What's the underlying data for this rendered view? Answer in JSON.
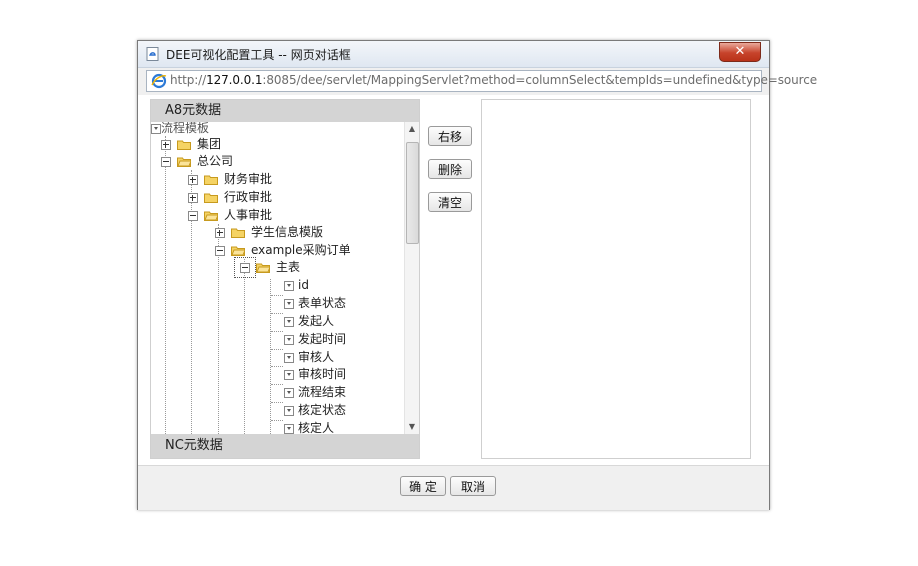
{
  "window": {
    "title": "DEE可视化配置工具 -- 网页对话框",
    "close_symbol": "✕"
  },
  "address": {
    "url_prefix": "http://",
    "url_host": "127.0.0.1",
    "url_rest": ":8085/dee/servlet/MappingServlet?method=columnSelect&tempIds=undefined&type=source"
  },
  "left_panel": {
    "header": "A8元数据",
    "footer_header": "NC元数据",
    "tree": [
      {
        "label": "流程模板",
        "type": "root"
      },
      {
        "label": "集团",
        "type": "folder",
        "expanded": false
      },
      {
        "label": "总公司",
        "type": "folder",
        "expanded": true
      },
      {
        "label": "财务审批",
        "type": "folder",
        "expanded": false
      },
      {
        "label": "行政审批",
        "type": "folder",
        "expanded": false
      },
      {
        "label": "人事审批",
        "type": "folder",
        "expanded": true
      },
      {
        "label": "学生信息模版",
        "type": "folder",
        "expanded": false
      },
      {
        "label": "example采购订单",
        "type": "folder",
        "expanded": true
      },
      {
        "label": "主表",
        "type": "folder",
        "expanded": true,
        "selected": true
      },
      {
        "label": "id",
        "type": "field"
      },
      {
        "label": "表单状态",
        "type": "field"
      },
      {
        "label": "发起人",
        "type": "field"
      },
      {
        "label": "发起时间",
        "type": "field"
      },
      {
        "label": "审核人",
        "type": "field"
      },
      {
        "label": "审核时间",
        "type": "field"
      },
      {
        "label": "流程结束",
        "type": "field"
      },
      {
        "label": "核定状态",
        "type": "field"
      },
      {
        "label": "核定人",
        "type": "field"
      }
    ]
  },
  "actions": {
    "move_right": "右移",
    "delete": "删除",
    "clear": "清空"
  },
  "footer": {
    "ok": "确 定",
    "cancel": "取消"
  },
  "colors": {
    "panel_header": "#d4d4d4",
    "close_button": "#c7432b",
    "folder": "#f2c94c"
  }
}
